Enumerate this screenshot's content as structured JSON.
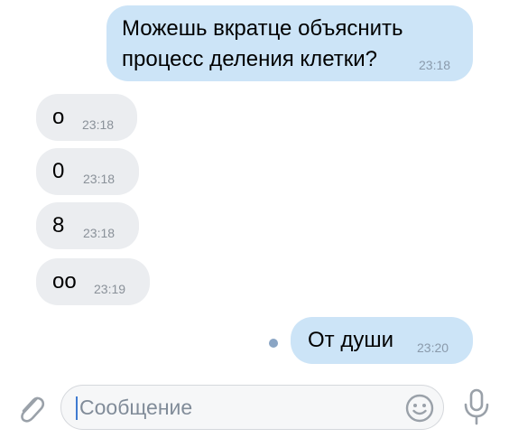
{
  "messages": [
    {
      "direction": "out",
      "lines": [
        "Можешь вкратце объяснить",
        "процесс деления клетки?"
      ],
      "time": "23:18"
    },
    {
      "direction": "in",
      "text": "о",
      "time": "23:18"
    },
    {
      "direction": "in",
      "text": "0",
      "time": "23:18"
    },
    {
      "direction": "in",
      "text": "8",
      "time": "23:18"
    },
    {
      "direction": "in",
      "text": "оо",
      "time": "23:19"
    },
    {
      "direction": "out",
      "text": "От души",
      "time": "23:20",
      "status": "unread"
    }
  ],
  "composer": {
    "placeholder": "Сообщение"
  },
  "colors": {
    "outgoing_bubble": "#cce4f7",
    "incoming_bubble": "#ebedf0",
    "icon_gray": "#9aa1a9",
    "unread_dot": "#8aa5c4"
  },
  "icons": [
    "paperclip-icon",
    "emoji-icon",
    "microphone-icon"
  ]
}
